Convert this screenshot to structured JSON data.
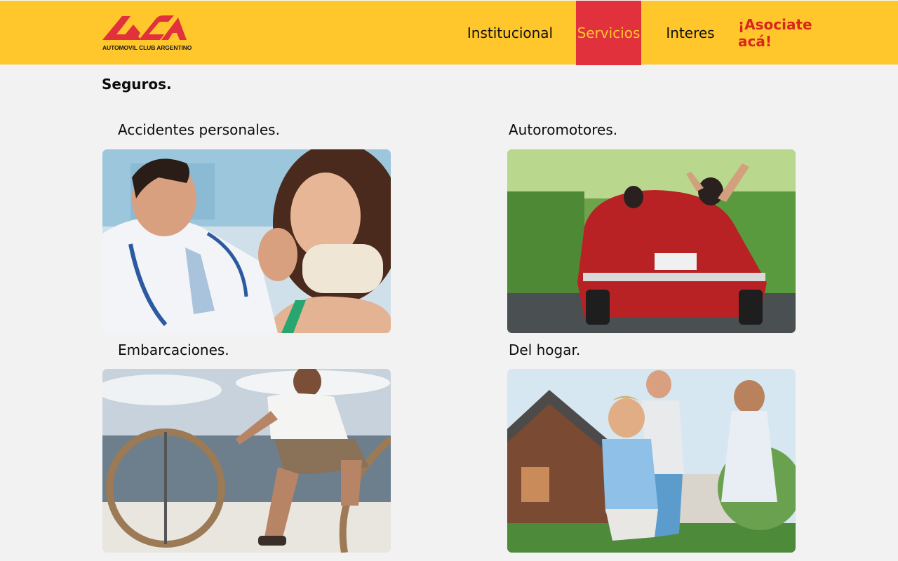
{
  "header": {
    "logo_text": "ACA",
    "logo_subtitle": "AUTOMOVIL CLUB ARGENTINO",
    "nav": [
      {
        "label": "Institucional",
        "active": false
      },
      {
        "label": "Servicios",
        "active": true
      },
      {
        "label": "Interes",
        "active": false
      },
      {
        "label": "¡Asociate acá!",
        "active": false
      }
    ]
  },
  "main": {
    "title": "Seguros.",
    "cards": [
      {
        "title": "Accidentes personales."
      },
      {
        "title": "Autoromotores."
      },
      {
        "title": "Embarcaciones."
      },
      {
        "title": "Del hogar."
      }
    ]
  },
  "colors": {
    "header_bg": "#ffc72c",
    "nav_active_bg": "#e0313c",
    "nav_active_text": "#ffc72c",
    "cta_text": "#d9261c",
    "page_bg": "#f2f2f2"
  }
}
